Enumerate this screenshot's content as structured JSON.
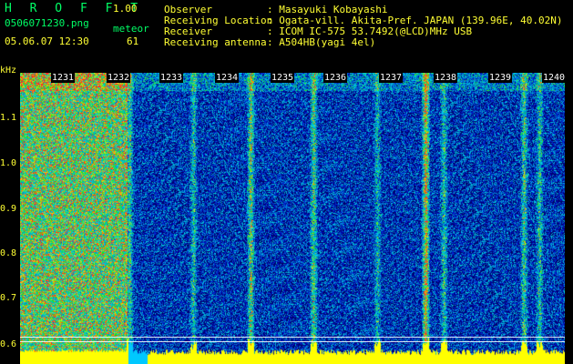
{
  "app": {
    "title": "H R O F F T",
    "version": "1.00"
  },
  "file": {
    "name": "0506071230.png",
    "datetime": "05.06.07 12:30"
  },
  "meteor": {
    "label": "meteor",
    "count": "61"
  },
  "info": {
    "observer_label": "Observer",
    "observer_value": ": Masayuki Kobayashi",
    "location_label": "Receiving Location",
    "location_value": ": Ogata-vill. Akita-Pref. JAPAN (139.96E, 40.02N)",
    "receiver_label": "Receiver",
    "receiver_value": ": ICOM IC-575 53.7492(@LCD)MHz USB",
    "antenna_label": "Receiving antenna",
    "antenna_value": ": A504HB(yagi 4el)"
  },
  "yaxis": {
    "unit": "kHz",
    "ticks": [
      "1.1",
      "1.0",
      "0.9",
      "0.8",
      "0.7",
      "0.6"
    ]
  },
  "time_marks": [
    "1231",
    "1232",
    "1233",
    "1234",
    "1235",
    "1236",
    "1237",
    "1238",
    "1239",
    "1240"
  ],
  "colors": {
    "label_green": "#00ff66",
    "label_yellow": "#ffff33",
    "background": "#000000"
  }
}
